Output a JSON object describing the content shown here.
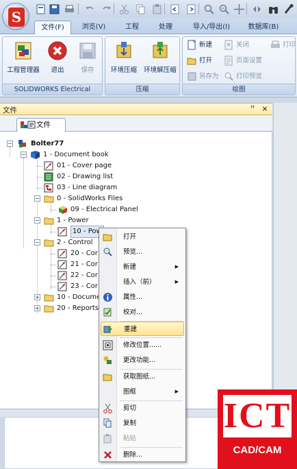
{
  "ribbon_tabs": [
    "文件(F)",
    "浏览(V)",
    "工程",
    "处理",
    "导入/导出(I)",
    "数据库(B)"
  ],
  "ribbon": {
    "groups": {
      "solidworks": {
        "label": "SOLIDWORKS Electrical",
        "project_manager": "工程管理器",
        "exit": "退出",
        "save": "保存"
      },
      "compress": {
        "label": "压缩",
        "compress_env": "环境压缩",
        "decompress_env": "环境解压缩"
      },
      "drawing": {
        "label": "绘图",
        "new": "新建",
        "close": "关闭",
        "print": "打印",
        "open": "打开",
        "page_setup": "页面设置",
        "save_as": "另存为",
        "print_preview": "打印预览"
      }
    }
  },
  "panel": {
    "title": "文件",
    "pin": "ᴴ",
    "close": "×",
    "tab_label": "文件"
  },
  "tree": {
    "root": "Bolter77",
    "book": "1 - Document book",
    "cover": "01 - Cover page",
    "drawing_list": "02 - Drawing list",
    "line_diagram": "03 - Line diagram",
    "sw_files": "0 - SolidWorks Files",
    "electrical_panel": "09 - Electrical Panel",
    "power": "1 - Power",
    "power_item": "10 - Pow",
    "control": "2 - Control",
    "c20": "20 - Cor",
    "c21": "21 - Cor",
    "c22": "22 - Cor",
    "c23": "23 - Cor",
    "documents": "10 - Docume",
    "reports": "20 - Reports"
  },
  "context_menu": {
    "open": "打开",
    "preview": "预览...",
    "new": "新建",
    "insert_before": "插入（前）",
    "properties": "属性...",
    "check": "校对...",
    "renumber": "重建",
    "modify_location": "修改位置......",
    "change_function": "更改功能...",
    "get_drawing": "获取图纸...",
    "frame": "图框",
    "cut": "剪切",
    "copy": "复制",
    "paste": "粘贴",
    "delete": "删除..."
  },
  "watermark": {
    "main": "ICT",
    "sub": "CAD/CAM"
  },
  "colors": {
    "accent": "#e20f1c",
    "highlight": "#ffe48f",
    "ribbon_blue": "#15305a"
  }
}
